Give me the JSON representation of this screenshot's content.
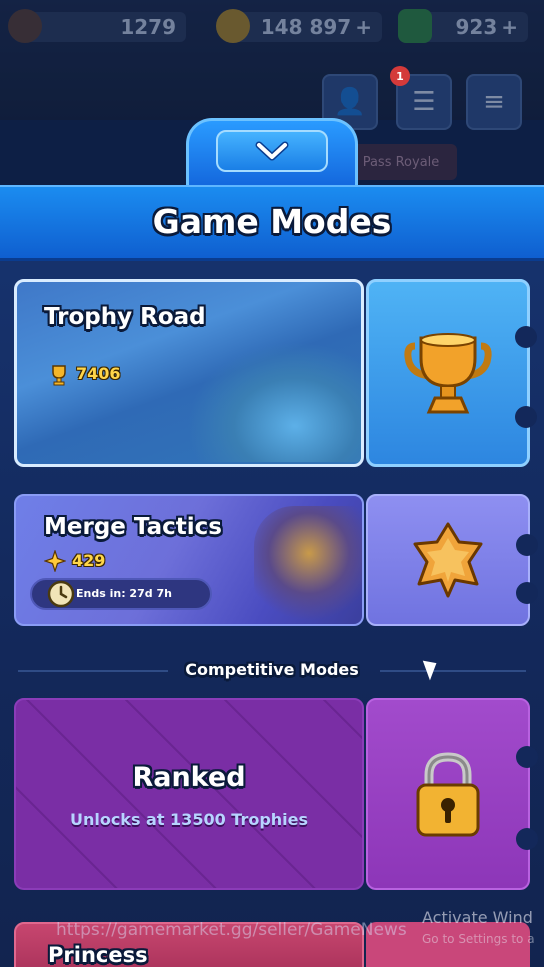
{
  "top_bar": {
    "trophies": "1279",
    "gold": "148 897",
    "gold_plus": "+",
    "gems": "923",
    "gems_plus": "+",
    "notification_count": "1",
    "event_hint": "Pass Royale"
  },
  "panel": {
    "title": "Game Modes",
    "collapse_icon": "chevron-down-icon"
  },
  "modes": {
    "trophy_road": {
      "title": "Trophy Road",
      "trophies": "7406",
      "stub_icon": "trophy-icon"
    },
    "merge_tactics": {
      "title": "Merge Tactics",
      "points": "429",
      "ends_in": "Ends in: 27d 7h",
      "stub_icon": "star-icon"
    }
  },
  "competitive": {
    "label": "Competitive Modes",
    "ranked": {
      "title": "Ranked",
      "subtitle": "Unlocks at 13500 Trophies",
      "stub_icon": "lock-icon"
    },
    "princess": {
      "title": "Princess"
    }
  },
  "overlay": {
    "watermark": "https://gamemarket.gg/seller/GameNews",
    "activate_title": "Activate Wind",
    "activate_sub": "Go to Settings to a"
  },
  "colors": {
    "header_blue": "#1b8cf0",
    "trophy_card": "#4b8fd8",
    "merge_card": "#6d6fd9",
    "ranked_card": "#7a2ea5",
    "princess_card": "#c7466f",
    "gold_text": "#ffd64a"
  }
}
